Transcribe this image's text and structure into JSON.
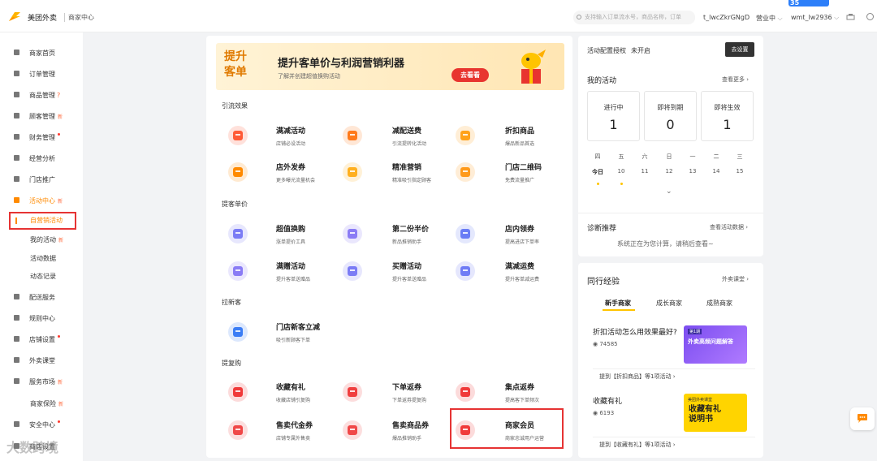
{
  "header": {
    "brand": "美团外卖",
    "brand_sub": "商家中心",
    "tag_number": "35",
    "search_placeholder": "支持输入订单流水号，商品名称，订单",
    "account_id": "t_lwcZkrGNgD",
    "status": "营业中",
    "user": "wmt_lw2936"
  },
  "sidebar": {
    "items": [
      {
        "label": "商家首页",
        "icon": "home-icon"
      },
      {
        "label": "订单管理",
        "icon": "order-icon"
      },
      {
        "label": "商品管理",
        "icon": "goods-icon",
        "extra": "?"
      },
      {
        "label": "顾客管理",
        "icon": "customer-icon",
        "badge": "新"
      },
      {
        "label": "财务管理",
        "icon": "finance-icon",
        "dot": true
      },
      {
        "label": "经营分析",
        "icon": "analysis-icon"
      },
      {
        "label": "门店推广",
        "icon": "promotion-icon"
      },
      {
        "label": "活动中心",
        "icon": "gift-icon",
        "badge": "新"
      },
      {
        "label": "自营销活动"
      },
      {
        "label": "我的活动",
        "badge": "新"
      },
      {
        "label": "活动数据"
      },
      {
        "label": "动态记录"
      },
      {
        "label": "配送服务",
        "icon": "delivery-icon"
      },
      {
        "label": "规则中心",
        "icon": "rules-icon"
      },
      {
        "label": "店铺设置",
        "icon": "settings-icon",
        "dot": true
      },
      {
        "label": "外卖课堂",
        "icon": "class-icon"
      },
      {
        "label": "服务市场",
        "icon": "market-icon",
        "badge": "新"
      },
      {
        "label": "商家保险",
        "badge": "新"
      },
      {
        "label": "安全中心",
        "icon": "security-icon",
        "dot": true
      },
      {
        "label": "商店设置",
        "icon": "shop-icon"
      }
    ],
    "watermark": "大数跨境"
  },
  "banner": {
    "left_text": "提升客单",
    "title": "提升客单价与利润营销利器",
    "subtitle": "了解并创建超值换购活动",
    "button": "去看看"
  },
  "sections": [
    {
      "title": "引流效果",
      "items": [
        {
          "name": "满减活动",
          "desc": "店铺必设活动",
          "icon": "discount-icon",
          "color": "#ff5a36"
        },
        {
          "name": "减配送费",
          "desc": "引流提转化活动",
          "icon": "delivery-fee-icon",
          "color": "#ff7a1a"
        },
        {
          "name": "折扣商品",
          "desc": "爆品新品首选",
          "icon": "discount-goods-icon",
          "color": "#ffa21a"
        },
        {
          "name": "店外发券",
          "desc": "更多曝光流量机会",
          "icon": "coupon-icon",
          "color": "#ff8a00"
        },
        {
          "name": "精准营销",
          "desc": "精准吸引指定顾客",
          "icon": "target-icon",
          "color": "#ffb020"
        },
        {
          "name": "门店二维码",
          "desc": "免费流量推广",
          "icon": "qrcode-icon",
          "color": "#ff9a1a"
        }
      ]
    },
    {
      "title": "提客单价",
      "items": [
        {
          "name": "超值换购",
          "desc": "涨单提价工具",
          "icon": "exchange-icon",
          "color": "#7b7cf5"
        },
        {
          "name": "第二份半价",
          "desc": "新品推销助手",
          "icon": "half-price-icon",
          "color": "#8b7cf5"
        },
        {
          "name": "店内领券",
          "desc": "提高进店下单率",
          "icon": "store-coupon-icon",
          "color": "#6a7df5"
        },
        {
          "name": "满赠活动",
          "desc": "提升客单送赠品",
          "icon": "gift-box-icon",
          "color": "#8a7cf5"
        },
        {
          "name": "买赠活动",
          "desc": "提升客单送赠品",
          "icon": "buy-gift-icon",
          "color": "#7b7cf5"
        },
        {
          "name": "满减运费",
          "desc": "提升客单减运费",
          "icon": "freight-icon",
          "color": "#6f7cf5"
        }
      ]
    },
    {
      "title": "拉新客",
      "items": [
        {
          "name": "门店新客立减",
          "desc": "吸引新顾客下单",
          "icon": "new-customer-icon",
          "color": "#3b7df5"
        }
      ]
    },
    {
      "title": "提复购",
      "items": [
        {
          "name": "收藏有礼",
          "desc": "收藏店铺引复购",
          "icon": "favorite-gift-icon",
          "color": "#f03a3a"
        },
        {
          "name": "下单返券",
          "desc": "下单返券提复购",
          "icon": "return-coupon-icon",
          "color": "#f04040"
        },
        {
          "name": "集点返券",
          "desc": "提高客下单频次",
          "icon": "points-icon",
          "color": "#f03a3a"
        },
        {
          "name": "售卖代金券",
          "desc": "店铺专属外售卖",
          "icon": "voucher-icon",
          "color": "#f04848"
        },
        {
          "name": "售卖商品券",
          "desc": "爆品推销助手",
          "icon": "goods-voucher-icon",
          "color": "#f04848"
        },
        {
          "name": "商家会员",
          "desc": "商家忠诚用户运营",
          "icon": "vip-icon",
          "color": "#f03a3a"
        }
      ]
    }
  ],
  "right": {
    "config_label": "活动配置授权",
    "config_status": "未开启",
    "config_button": "去设置",
    "my_activities": "我的活动",
    "see_more": "查看更多",
    "stats": [
      {
        "label": "进行中",
        "value": "1"
      },
      {
        "label": "即将到期",
        "value": "0"
      },
      {
        "label": "即将生效",
        "value": "1"
      }
    ],
    "calendar": {
      "weekdays": [
        "四",
        "五",
        "六",
        "日",
        "一",
        "二",
        "三"
      ],
      "dates": [
        "今日",
        "10",
        "11",
        "12",
        "13",
        "14",
        "15"
      ]
    },
    "diagnosis_title": "诊断推荐",
    "diagnosis_link": "查看活动数据",
    "diagnosis_text": "系统正在为您计算，请稍后查看~",
    "peer_title": "同行经验",
    "peer_link": "外卖课堂",
    "tabs": [
      "新手商家",
      "成长商家",
      "成熟商家"
    ],
    "articles": [
      {
        "title": "折扣活动怎么用效果最好?",
        "views": "74585",
        "img_text": "外卖高频问题解答",
        "img_tag": "第1期",
        "link": "提到【折扣商品】等1项活动"
      },
      {
        "title": "收藏有礼",
        "views": "6193",
        "img_text": "收藏有礼说明书",
        "img_tag": "美团外卖课堂",
        "link": "提到【收藏有礼】等1项活动"
      }
    ]
  }
}
